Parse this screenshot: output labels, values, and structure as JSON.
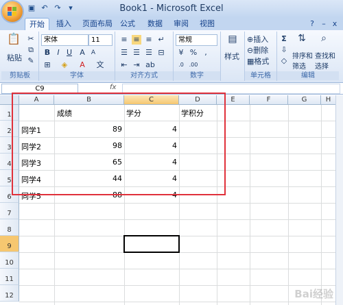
{
  "window": {
    "title": "Book1 - Microsoft Excel"
  },
  "tabs": [
    "开始",
    "插入",
    "页面布局",
    "公式",
    "数据",
    "审阅",
    "视图"
  ],
  "ribbon": {
    "clipboard": {
      "label": "剪贴板",
      "paste": "粘贴"
    },
    "font": {
      "label": "字体",
      "name": "宋体",
      "size": "11"
    },
    "alignment": {
      "label": "对齐方式"
    },
    "number": {
      "label": "数字",
      "format": "常规"
    },
    "styles": {
      "label": "样式"
    },
    "cells": {
      "label": "单元格",
      "insert": "插入",
      "delete": "删除",
      "format": "格式"
    },
    "editing": {
      "label": "编辑",
      "sort": "排序和",
      "filter": "筛选",
      "find": "查找和",
      "select": "选择"
    }
  },
  "formula_bar": {
    "name_box": "C9",
    "fx": "fx"
  },
  "columns": [
    "A",
    "B",
    "C",
    "D",
    "E",
    "F",
    "G",
    "H"
  ],
  "rows": [
    "1",
    "2",
    "3",
    "4",
    "5",
    "6",
    "7",
    "8",
    "9",
    "10",
    "11",
    "12"
  ],
  "table": {
    "header": {
      "b": "成绩",
      "c": "学分",
      "d": "学积分"
    },
    "rows": [
      {
        "name": "同学1",
        "score": "89",
        "credit": "4"
      },
      {
        "name": "同学2",
        "score": "98",
        "credit": "4"
      },
      {
        "name": "同学3",
        "score": "65",
        "credit": "4"
      },
      {
        "name": "同学4",
        "score": "44",
        "credit": "4"
      },
      {
        "name": "同学5",
        "score": "88",
        "credit": "4"
      }
    ]
  },
  "watermark": "Bai经验",
  "colors": {
    "selection": "#000000",
    "highlight_box": "#e0303a",
    "selected_header": "#f6c770"
  }
}
